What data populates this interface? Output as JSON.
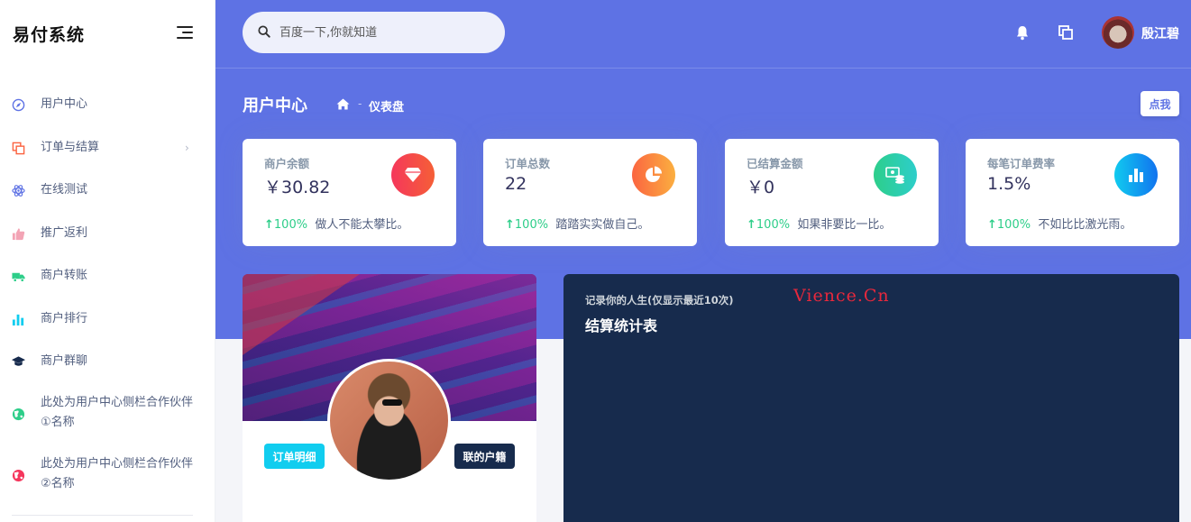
{
  "sidebar": {
    "brand": "易付系统",
    "items": [
      {
        "label": "用户中心",
        "icon": "compass-icon"
      },
      {
        "label": "订单与结算",
        "icon": "copy-icon",
        "has_submenu": true
      },
      {
        "label": "在线测试",
        "icon": "atom-icon"
      },
      {
        "label": "推广返利",
        "icon": "thumbs-up-icon"
      },
      {
        "label": "商户转账",
        "icon": "truck-icon"
      },
      {
        "label": "商户排行",
        "icon": "bar-chart-icon"
      },
      {
        "label": "商户群聊",
        "icon": "graduation-cap-icon"
      },
      {
        "label": "此处为用户中心侧栏合作伙伴①名称",
        "icon": "globe-green-icon"
      },
      {
        "label": "此处为用户中心侧栏合作伙伴②名称",
        "icon": "globe-red-icon"
      }
    ]
  },
  "header": {
    "search_placeholder": "百度一下,你就知道",
    "user_name": "殷江碧"
  },
  "page": {
    "title": "用户中心",
    "breadcrumb_sep": "-",
    "breadcrumb_current": "仪表盘",
    "action_button": "点我"
  },
  "stats": [
    {
      "label": "商户余额",
      "value": "￥30.82",
      "arrow": "↑",
      "pct": "100%",
      "note": "做人不能太攀比。",
      "icon": "diamond-icon",
      "color": "#f5365c"
    },
    {
      "label": "订单总数",
      "value": "22",
      "arrow": "↑",
      "pct": "100%",
      "note": "踏踏实实做自己。",
      "icon": "pie-chart-icon",
      "color": "#fb6340"
    },
    {
      "label": "已结算金额",
      "value": "￥0",
      "arrow": "↑",
      "pct": "100%",
      "note": "如果非要比一比。",
      "icon": "money-stack-icon",
      "color": "#2dce89"
    },
    {
      "label": "每笔订单费率",
      "value": "1.5%",
      "arrow": "↑",
      "pct": "100%",
      "note": "不如比比激光雨。",
      "icon": "bar-chart-icon",
      "color": "#11cdef"
    }
  ],
  "profile": {
    "orders_button": "订单明细",
    "contact_button": "联的户籍"
  },
  "chart_card": {
    "subtitle": "记录你的人生(仅显示最近10次)",
    "title": "结算统计表"
  },
  "watermark": "Vience.Cn",
  "colors": {
    "primary": "#5e72e4",
    "dark": "#172b4d",
    "success": "#2dce89"
  }
}
